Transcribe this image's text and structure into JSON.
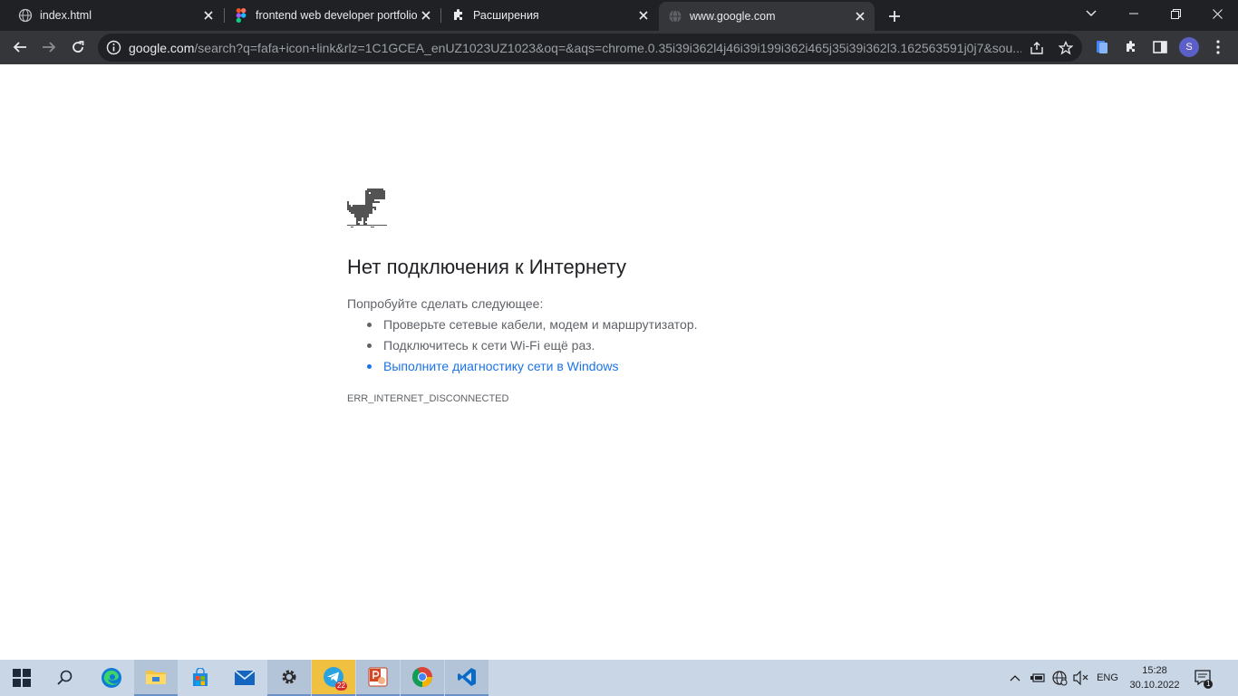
{
  "browser": {
    "tabs": [
      {
        "title": "index.html",
        "favicon": "globe-icon",
        "active": false
      },
      {
        "title": "frontend web developer portfolio",
        "favicon": "figma-icon",
        "active": false
      },
      {
        "title": "Расширения",
        "favicon": "puzzle-icon",
        "active": false
      },
      {
        "title": "www.google.com",
        "favicon": "globe-icon",
        "active": true
      }
    ],
    "address": {
      "host": "google.com",
      "path": "/search?q=fafa+icon+link&rlz=1C1GCEA_enUZ1023UZ1023&oq=&aqs=chrome.0.35i39i362l4j46i39i199i362i465j35i39i362l3.162563591j0j7&sou..."
    },
    "profile_initial": "S"
  },
  "page": {
    "heading": "Нет подключения к Интернету",
    "suggest_label": "Попробуйте сделать следующее:",
    "suggestions": [
      "Проверьте сетевые кабели, модем и маршрутизатор.",
      "Подключитесь к сети Wi-Fi ещё раз.",
      "Выполните диагностику сети в Windows"
    ],
    "error_code": "ERR_INTERNET_DISCONNECTED"
  },
  "taskbar": {
    "telegram_badge": "22",
    "language": "ENG",
    "time": "15:28",
    "date": "30.10.2022",
    "notification_count": "1"
  },
  "colors": {
    "accent_link": "#1a73e8",
    "browser_frame": "#202124",
    "toolbar": "#35363a",
    "taskbar": "#c9d6e6"
  }
}
